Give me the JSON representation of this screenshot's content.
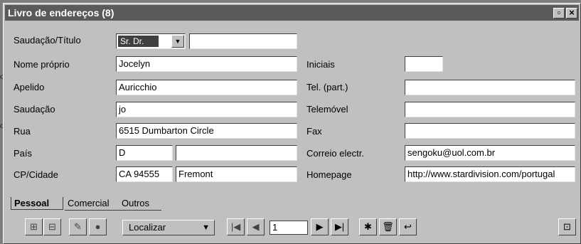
{
  "window": {
    "title": "Livro de endereços (8)",
    "controls": {
      "maximize": "▫",
      "close": "×"
    }
  },
  "form": {
    "salutation_title": {
      "label": "Saudação/Título",
      "selected": "Sr. Dr.",
      "extra_value": ""
    },
    "first_name": {
      "label": "Nome próprio",
      "value": "Jocelyn"
    },
    "last_name": {
      "label": "Apelido",
      "value": "Auricchio"
    },
    "greeting": {
      "label": "Saudação",
      "value": "jo"
    },
    "street": {
      "label": "Rua",
      "value": "6515 Dumbarton Circle"
    },
    "country": {
      "label": "País",
      "value": "D",
      "extra_value": ""
    },
    "zip_city": {
      "label": "CP/Cidade",
      "zip": "CA 94555",
      "city": "Fremont"
    },
    "initials": {
      "label": "Iniciais",
      "value": ""
    },
    "phone_home": {
      "label": "Tel. (part.)",
      "value": ""
    },
    "mobile": {
      "label": "Telemóvel",
      "value": ""
    },
    "fax": {
      "label": "Fax",
      "value": ""
    },
    "email": {
      "label": "Correio electr.",
      "value": "sengoku@uol.com.br"
    },
    "homepage": {
      "label": "Homepage",
      "value": "http://www.stardivision.com/portugal"
    }
  },
  "tabs": [
    "Pessoal",
    "Comercial",
    "Outros"
  ],
  "toolbar": {
    "find_label": "Localizar",
    "record_number": "1",
    "icons": [
      "insert-record-icon",
      "delete-record-icon",
      "edit-icon",
      "globe-icon",
      "first-record-icon",
      "previous-record-icon",
      "next-record-icon",
      "last-record-icon",
      "new-record-icon",
      "trash-icon",
      "undo-icon",
      "data-source-icon"
    ]
  },
  "background": {
    "fragments": [
      "o",
      "o."
    ]
  },
  "colors": {
    "titlebar": "#5a5a5a",
    "window_bg": "#c0c0c0",
    "field_bg": "#ffffff"
  }
}
